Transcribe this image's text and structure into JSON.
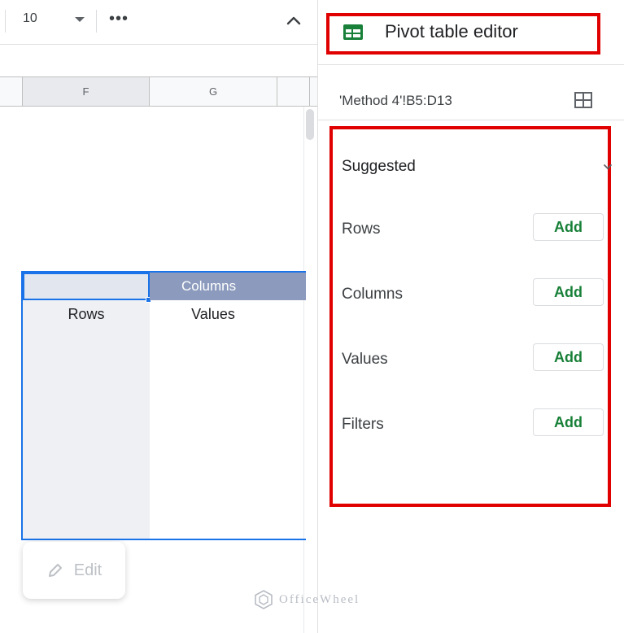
{
  "toolbar": {
    "font_size": "10",
    "more_label": "•••"
  },
  "sheet": {
    "columns": [
      "F",
      "G"
    ],
    "pivot": {
      "columns_label": "Columns",
      "rows_label": "Rows",
      "values_label": "Values"
    },
    "edit_label": "Edit"
  },
  "editor": {
    "title": "Pivot table editor",
    "range": "'Method 4'!B5:D13",
    "suggested_label": "Suggested",
    "sections": [
      {
        "label": "Rows",
        "button": "Add"
      },
      {
        "label": "Columns",
        "button": "Add"
      },
      {
        "label": "Values",
        "button": "Add"
      },
      {
        "label": "Filters",
        "button": "Add"
      }
    ]
  },
  "watermark": "OfficeWheel",
  "colors": {
    "selection_blue": "#1a73e8",
    "highlight_red": "#e00000",
    "add_green": "#188038",
    "pivot_header": "#8c9bbd",
    "sheets_green": "#188038"
  },
  "icons": [
    "chevron-up-icon",
    "caret-down-icon",
    "more-icon",
    "sheets-icon",
    "grid-select-icon",
    "chevron-down-icon",
    "pencil-icon",
    "logo-icon"
  ]
}
